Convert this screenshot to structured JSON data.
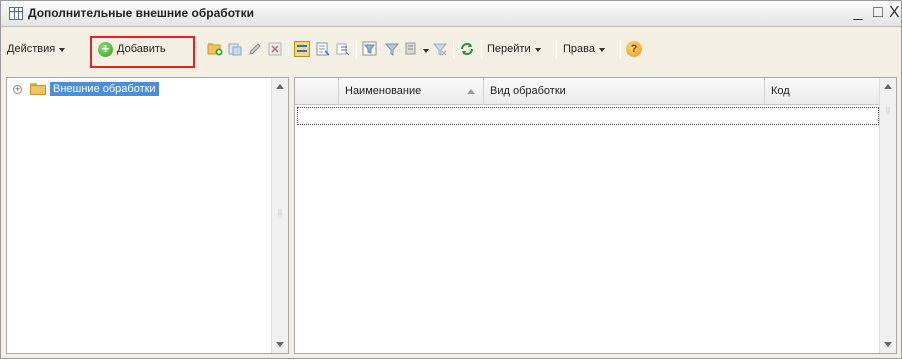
{
  "window": {
    "title": "Дополнительные внешние обработки",
    "min_label": "_",
    "max_label": "□",
    "close_label": "X"
  },
  "toolbar": {
    "actions_label": "Действия",
    "add_label_accel": "Д",
    "add_label_rest": "обавить",
    "goto_label": "Перейти",
    "rights_label": "Права",
    "help_label": "?"
  },
  "tree": {
    "root_label": "Внешние обработки",
    "expand_glyph": "+"
  },
  "table": {
    "columns": [
      "Наименование",
      "Вид обработки",
      "Код"
    ]
  },
  "colors": {
    "highlight": "#e5202b",
    "selection": "#4a8fd8",
    "window_bg": "#f3efe2"
  }
}
